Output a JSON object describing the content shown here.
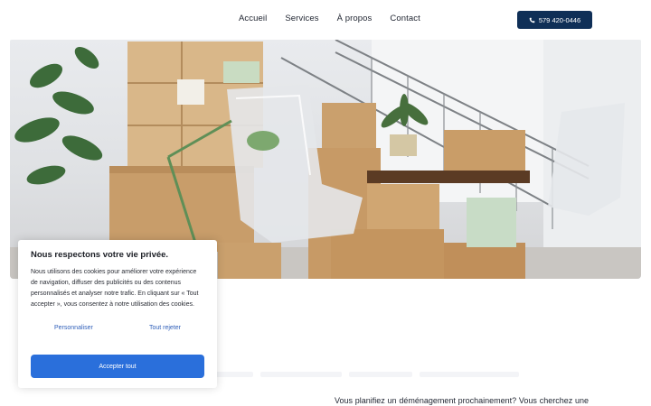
{
  "nav": {
    "items": [
      "Accueil",
      "Services",
      "À propos",
      "Contact"
    ],
    "phone": "579 420-0446"
  },
  "hero": {
    "icon": "moving-boxes-photo"
  },
  "section": {
    "intro": "Vous planifiez un déménagement prochainement? Vous cherchez une"
  },
  "cookie": {
    "title": "Nous respectons votre vie privée.",
    "body": "Nous utilisons des cookies pour améliorer votre expérience de navigation, diffuser des publicités ou des contenus personnalisés et analyser notre trafic. En cliquant sur « Tout accepter », vous consentez à notre utilisation des cookies.",
    "customize": "Personnaliser",
    "reject": "Tout rejeter",
    "accept": "Accepter tout"
  },
  "colors": {
    "primary": "#0f2f57",
    "accent": "#2a6fdb",
    "link": "#2f5fb9"
  }
}
